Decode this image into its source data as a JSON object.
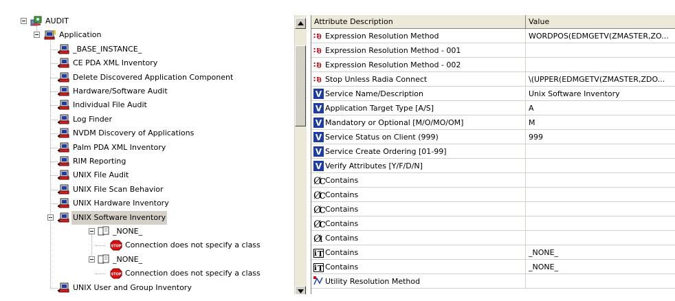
{
  "tree": {
    "root": {
      "label": "AUDIT",
      "icon": "audit-class-icon"
    },
    "application": {
      "label": "Application",
      "icon": "application-class-icon"
    },
    "instances": [
      "_BASE_INSTANCE_",
      "CE PDA XML Inventory",
      "Delete Discovered Application Component",
      "Hardware/Software Audit",
      "Individual File Audit",
      "Log Finder",
      "NVDM Discovery of Applications",
      "Palm PDA XML Inventory",
      "RIM Reporting",
      "UNIX File Audit",
      "UNIX File Scan Behavior",
      "UNIX Hardware Inventory",
      "UNIX Software Inventory"
    ],
    "selected_instance": "UNIX Software Inventory",
    "connections": [
      {
        "label": "_NONE_",
        "child": "Connection does not specify a class"
      },
      {
        "label": "_NONE_",
        "child": "Connection does not specify a class"
      }
    ],
    "last_instance": "UNIX User and Group Inventory"
  },
  "table": {
    "headers": {
      "description": "Attribute Description",
      "value": "Value"
    },
    "rows": [
      {
        "icon": "expression-icon",
        "description": "Expression Resolution Method",
        "value": "WORDPOS(EDMGETV(ZMASTER,ZO..."
      },
      {
        "icon": "expression-icon",
        "description": "Expression Resolution Method - 001",
        "value": ""
      },
      {
        "icon": "expression-icon",
        "description": "Expression Resolution Method - 002",
        "value": ""
      },
      {
        "icon": "expression-icon",
        "description": "Stop Unless Radia Connect",
        "value": "\\(UPPER(EDMGETV(ZMASTER,ZDO..."
      },
      {
        "icon": "variable-icon",
        "description": "Service Name/Description",
        "value": "Unix Software Inventory"
      },
      {
        "icon": "variable-icon",
        "description": "Application Target Type [A/S]",
        "value": "A"
      },
      {
        "icon": "variable-icon",
        "description": "Mandatory or Optional [M/O/MO/OM]",
        "value": "M"
      },
      {
        "icon": "variable-icon",
        "description": "Service Status on Client (999)",
        "value": "999"
      },
      {
        "icon": "variable-icon",
        "description": "Service Create Ordering [01-99]",
        "value": ""
      },
      {
        "icon": "variable-icon",
        "description": "Verify Attributes [Y/F/D/N]",
        "value": ""
      },
      {
        "icon": "class-connection-icon",
        "description": "Contains",
        "value": ""
      },
      {
        "icon": "class-connection-icon",
        "description": "Contains",
        "value": ""
      },
      {
        "icon": "class-connection-icon",
        "description": "Contains",
        "value": ""
      },
      {
        "icon": "class-connection-icon",
        "description": "Contains",
        "value": ""
      },
      {
        "icon": "includes-connection-icon",
        "description": "Contains",
        "value": ""
      },
      {
        "icon": "always-connection-icon",
        "description": "Contains",
        "value": "_NONE_"
      },
      {
        "icon": "always-connection-icon",
        "description": "Contains",
        "value": "_NONE_"
      },
      {
        "icon": "method-icon",
        "description": "Utility Resolution Method",
        "value": ""
      }
    ]
  },
  "colors": {
    "selection": "#d4d0c8",
    "variable_icon": "#1e3ca8",
    "expression_icon": "#c0141e",
    "stop_icon": "#d81010"
  }
}
